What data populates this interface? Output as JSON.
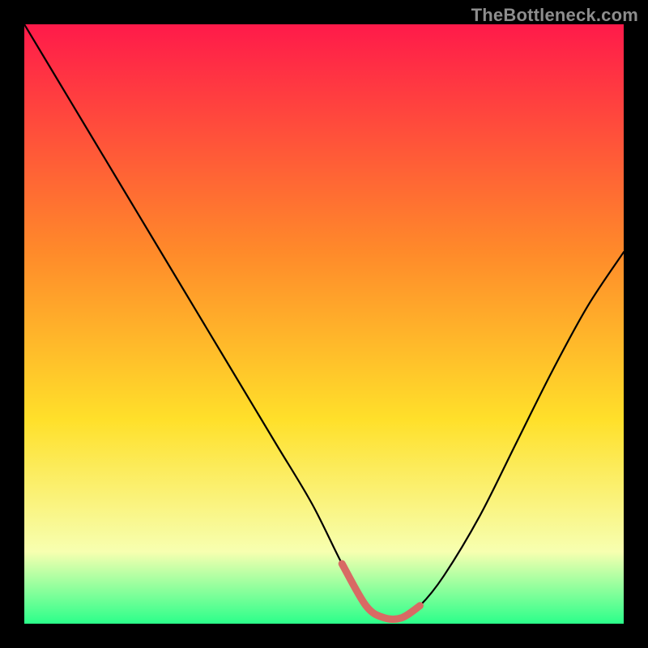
{
  "watermark": "TheBottleneck.com",
  "colors": {
    "gradient_top": "#ff1a4a",
    "gradient_mid1": "#ff8a2a",
    "gradient_mid2": "#ffe02a",
    "gradient_bottom1": "#f7ffb0",
    "gradient_bottom2": "#2bff8a",
    "curve": "#000000",
    "highlight": "#d86a64",
    "frame": "#000000"
  },
  "chart_data": {
    "type": "line",
    "title": "",
    "xlabel": "",
    "ylabel": "",
    "xlim": [
      0,
      100
    ],
    "ylim": [
      0,
      100
    ],
    "series": [
      {
        "name": "bottleneck-curve",
        "x": [
          0,
          6,
          12,
          18,
          24,
          30,
          36,
          42,
          48,
          53,
          57,
          60,
          63,
          66,
          70,
          76,
          82,
          88,
          94,
          100
        ],
        "y": [
          100,
          90,
          80,
          70,
          60,
          50,
          40,
          30,
          20,
          10,
          3,
          1,
          1,
          3,
          8,
          18,
          30,
          42,
          53,
          62
        ]
      }
    ],
    "highlight_region": {
      "name": "valley-highlight",
      "x": [
        53,
        66
      ],
      "y": [
        0.5,
        4
      ]
    },
    "gradient_fill": true,
    "legend": false,
    "grid": false
  }
}
